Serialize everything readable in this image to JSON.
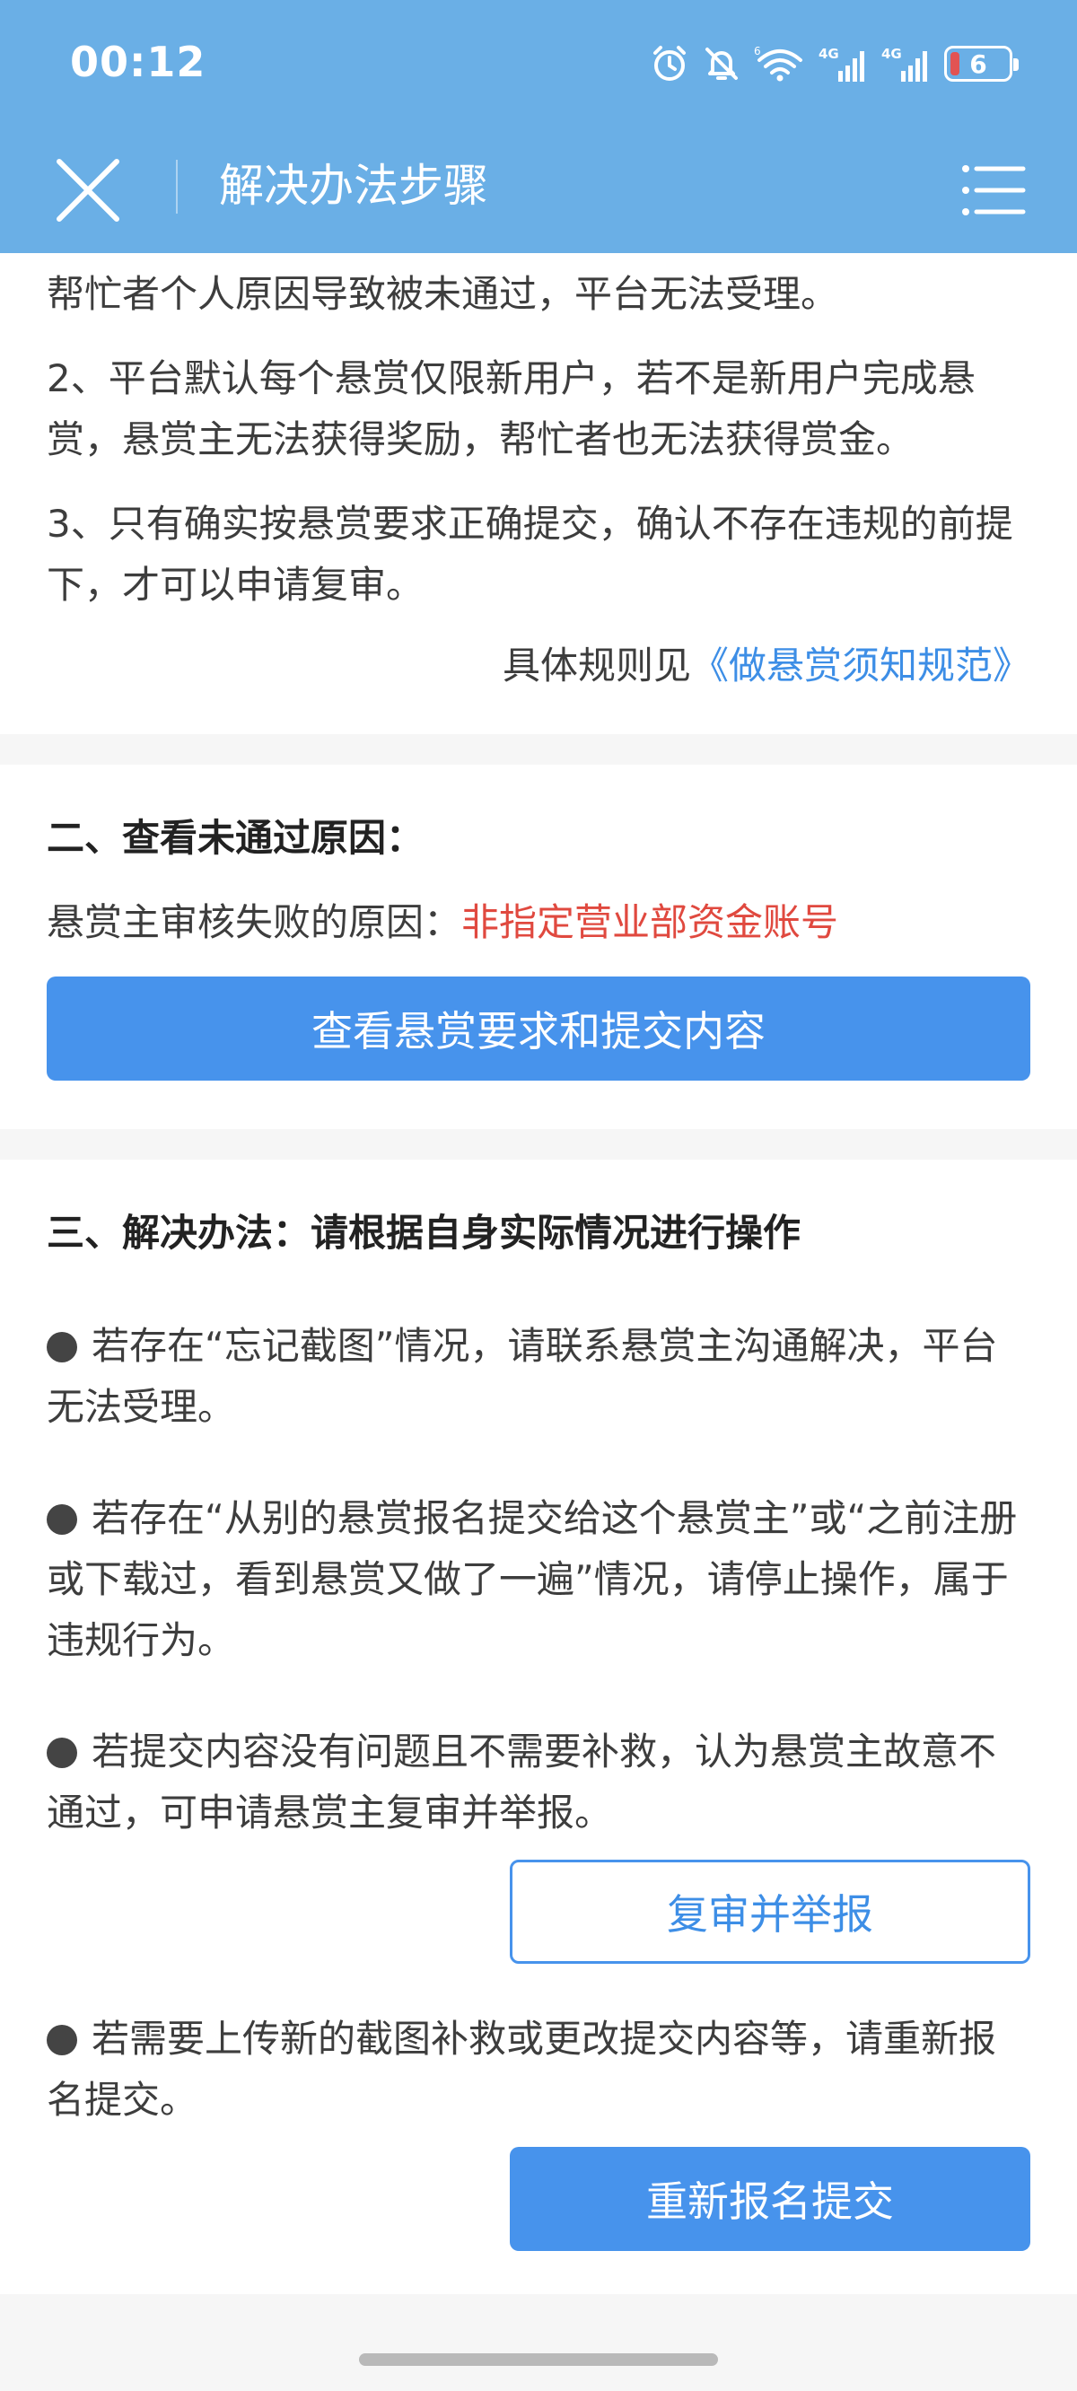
{
  "status_bar": {
    "time": "00:12",
    "battery_level": "6",
    "icons": [
      "alarm-icon",
      "mute-icon",
      "wifi-icon",
      "signal-4g-icon",
      "signal-4g-icon-2",
      "battery-icon"
    ]
  },
  "nav": {
    "title": "解决办法步骤",
    "close_icon": "close-icon",
    "menu_icon": "menu-icon"
  },
  "section1": {
    "line1": "帮忙者个人原因导致被未通过，平台无法受理。",
    "item2": "2、平台默认每个悬赏仅限新用户，若不是新用户完成悬赏，悬赏主无法获得奖励，帮忙者也无法获得赏金。",
    "item3": "3、只有确实按悬赏要求正确提交，确认不存在违规的前提下，才可以申请复审。",
    "rule_prefix": "具体规则见",
    "rule_link": "《做悬赏须知规范》"
  },
  "section2": {
    "heading": "二、查看未通过原因：",
    "reason_label": "悬赏主审核失败的原因：",
    "reason_value": "非指定营业部资金账号",
    "view_button": "查看悬赏要求和提交内容"
  },
  "section3": {
    "heading": "三、解决办法：请根据自身实际情况进行操作",
    "bullet1": "若存在“忘记截图”情况，请联系悬赏主沟通解决，平台无法受理。",
    "bullet2": "若存在“从别的悬赏报名提交给这个悬赏主”或“之前注册或下载过，看到悬赏又做了一遍”情况，请停止操作，属于违规行为。",
    "bullet3": "若提交内容没有问题且不需要补救，认为悬赏主故意不通过，可申请悬赏主复审并举报。",
    "review_button": "复审并举报",
    "bullet4": "若需要上传新的截图补救或更改提交内容等，请重新报名提交。",
    "resubmit_button": "重新报名提交"
  },
  "colors": {
    "header": "#6aafe6",
    "primary": "#4793ec",
    "link": "#3d8ee6",
    "error": "#e0493f"
  }
}
